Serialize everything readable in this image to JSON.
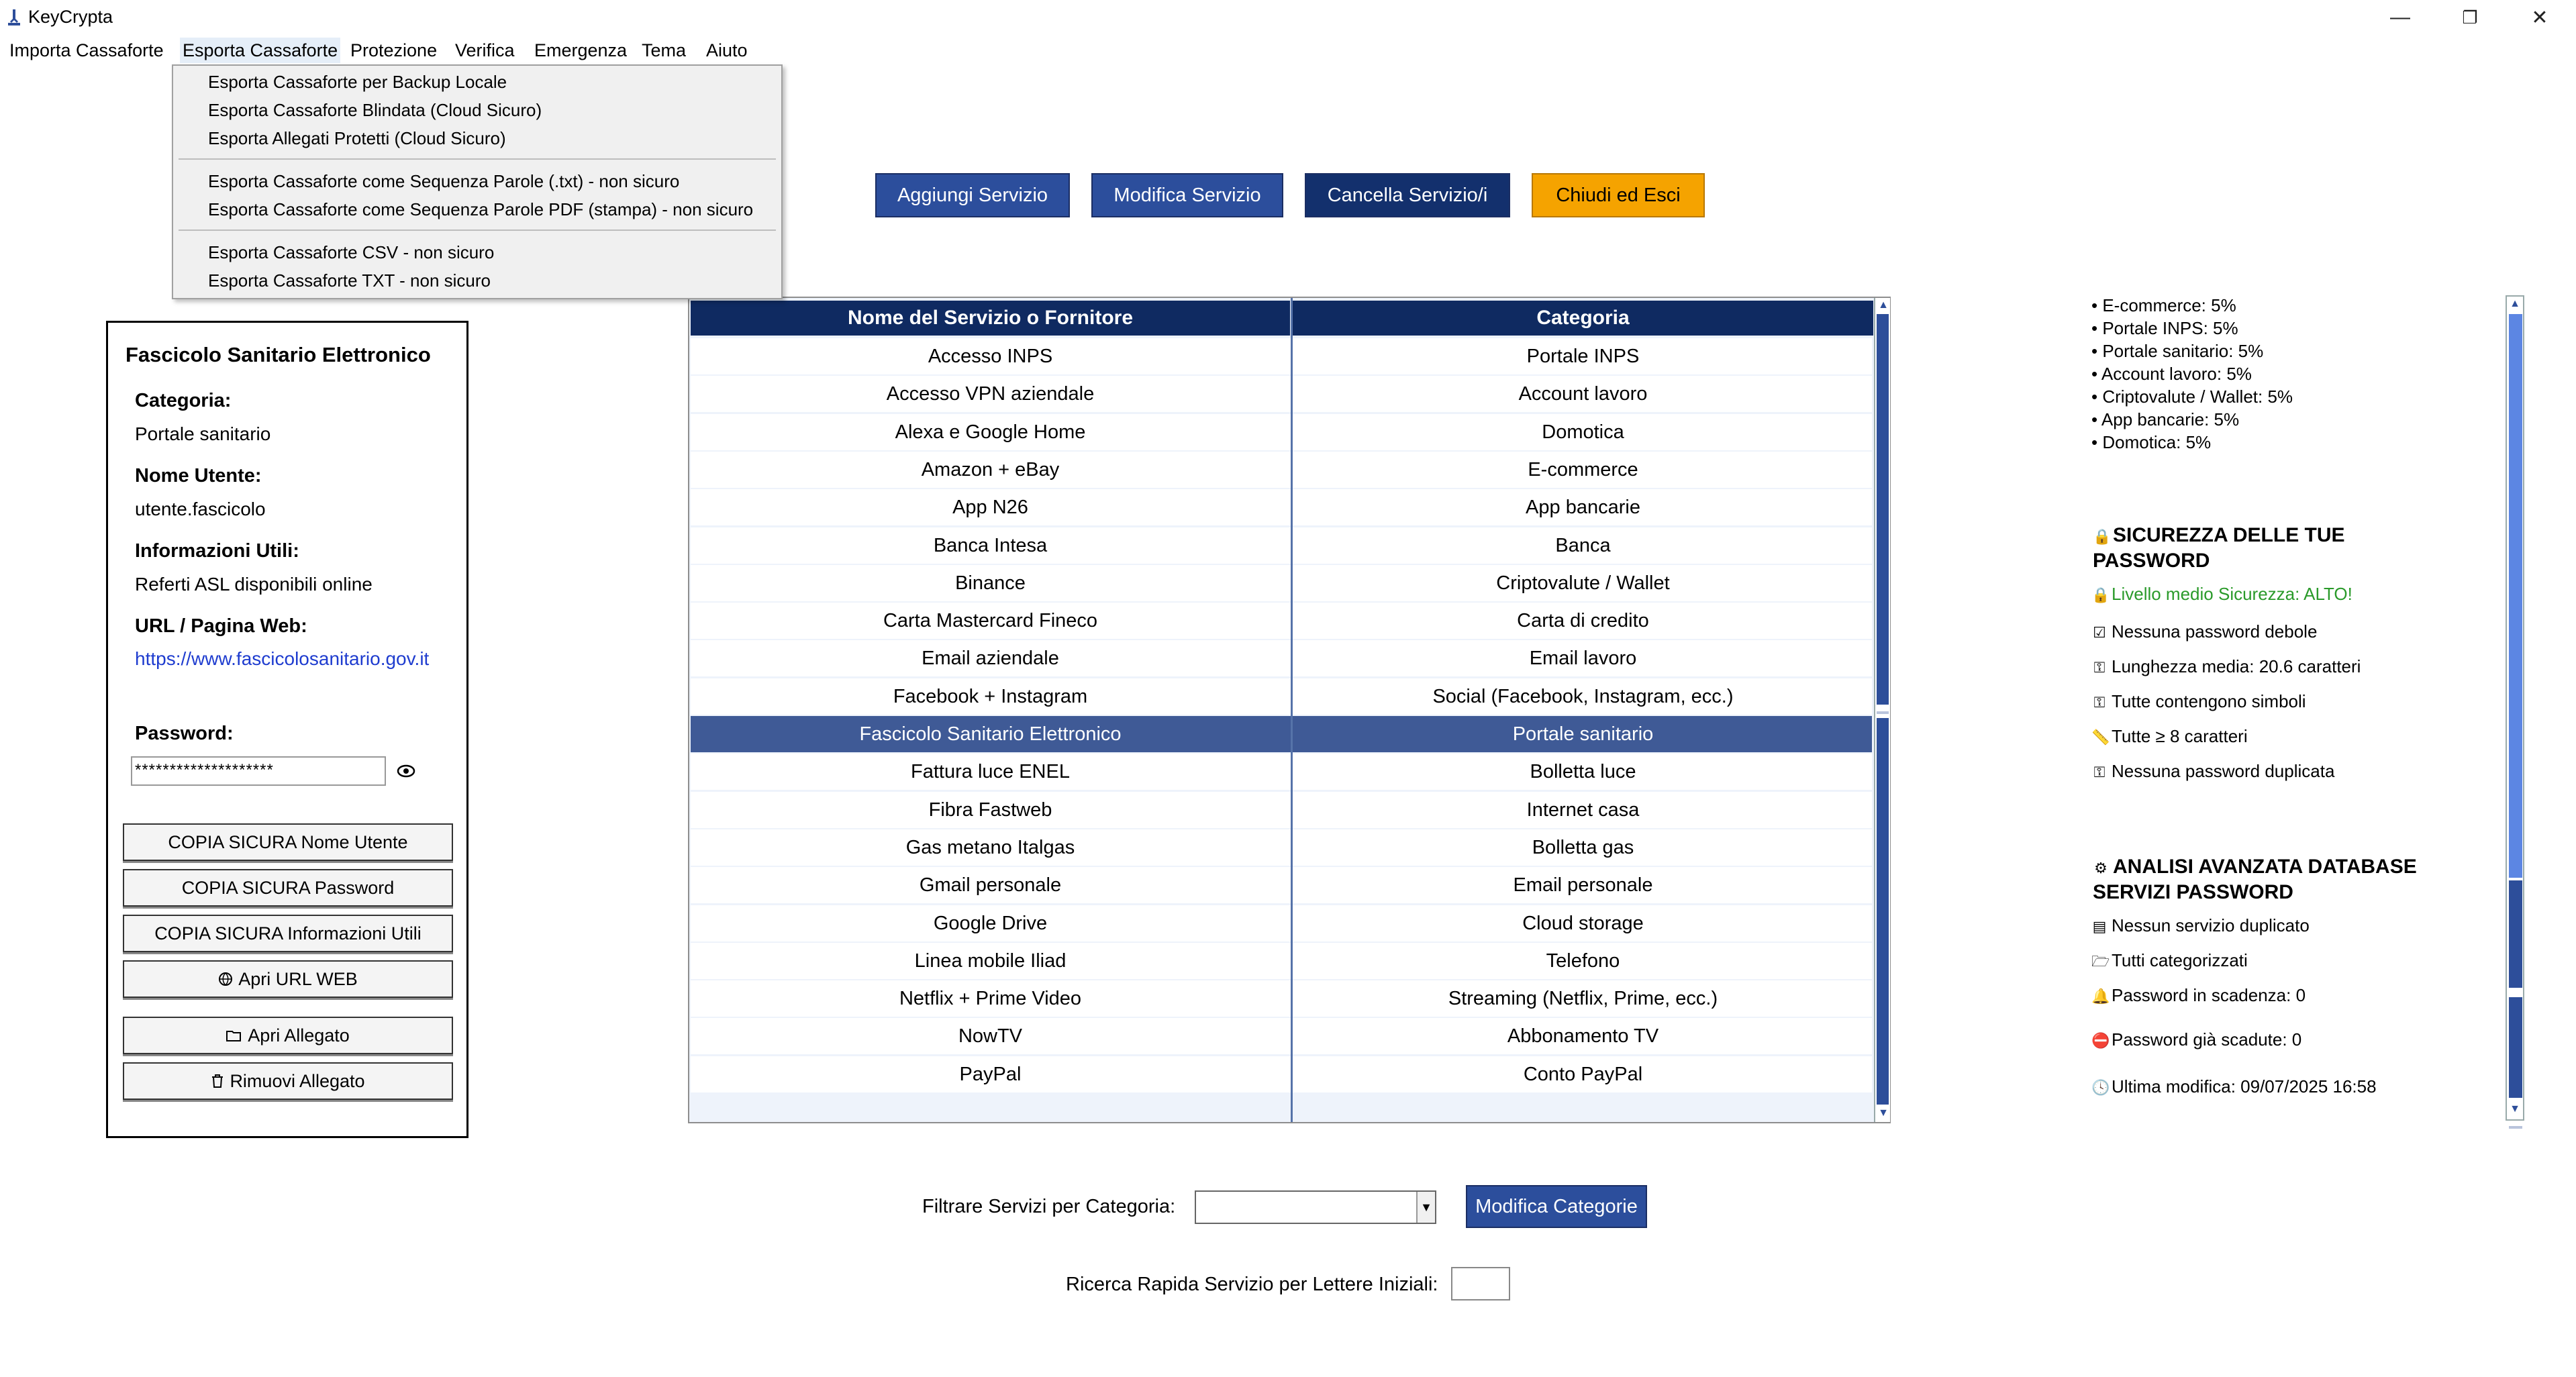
{
  "window": {
    "title": "KeyCrypta",
    "controls": {
      "minimize": "—",
      "maximize": "❐",
      "close": "✕"
    }
  },
  "menubar": {
    "items": [
      "Importa Cassaforte",
      "Esporta Cassaforte",
      "Protezione",
      "Verifica",
      "Emergenza",
      "Tema",
      "Aiuto"
    ]
  },
  "export_menu": {
    "items": [
      "Esporta Cassaforte per Backup Locale",
      "Esporta Cassaforte Blindata (Cloud Sicuro)",
      "Esporta Allegati Protetti (Cloud Sicuro)",
      "Esporta Cassaforte come Sequenza Parole (.txt) - non sicuro",
      "Esporta Cassaforte come Sequenza Parole PDF (stampa) - non sicuro",
      "Esporta Cassaforte CSV - non sicuro",
      "Esporta Cassaforte TXT - non sicuro"
    ]
  },
  "toolbar": {
    "add": "Aggiungi Servizio",
    "edit": "Modifica Servizio",
    "delete": "Cancella Servizio/i",
    "exit": "Chiudi ed Esci",
    "colors": {
      "blue": "#2c4e9c",
      "dark": "#13306d",
      "orange": "#f5a300"
    }
  },
  "details": {
    "title": "Fascicolo Sanitario Elettronico",
    "category_label": "Categoria:",
    "category": "Portale sanitario",
    "username_label": "Nome Utente:",
    "username": "utente.fascicolo",
    "info_label": "Informazioni Utili:",
    "info": "Referti ASL disponibili online",
    "url_label": "URL / Pagina Web:",
    "url": "https://www.fascicolosanitario.gov.it",
    "password_label": "Password:",
    "password_masked": "********************",
    "buttons": {
      "copy_user": "COPIA SICURA Nome Utente",
      "copy_password": "COPIA SICURA Password",
      "copy_info": "COPIA SICURA Informazioni Utili",
      "open_url": "Apri URL WEB",
      "open_attachment": "Apri Allegato",
      "remove_attachment": "Rimuovi Allegato"
    }
  },
  "table": {
    "headers": [
      "Nome del Servizio o Fornitore",
      "Categoria"
    ],
    "selected_index": 10,
    "rows": [
      [
        "Accesso INPS",
        "Portale INPS"
      ],
      [
        "Accesso VPN aziendale",
        "Account lavoro"
      ],
      [
        "Alexa e Google Home",
        "Domotica"
      ],
      [
        "Amazon + eBay",
        "E-commerce"
      ],
      [
        "App N26",
        "App bancarie"
      ],
      [
        "Banca Intesa",
        "Banca"
      ],
      [
        "Binance",
        "Criptovalute / Wallet"
      ],
      [
        "Carta Mastercard Fineco",
        "Carta di credito"
      ],
      [
        "Email aziendale",
        "Email lavoro"
      ],
      [
        "Facebook + Instagram",
        "Social (Facebook, Instagram, ecc.)"
      ],
      [
        "Fascicolo Sanitario Elettronico",
        "Portale sanitario"
      ],
      [
        "Fattura luce ENEL",
        "Bolletta luce"
      ],
      [
        "Fibra Fastweb",
        "Internet casa"
      ],
      [
        "Gas metano Italgas",
        "Bolletta gas"
      ],
      [
        "Gmail personale",
        "Email personale"
      ],
      [
        "Google Drive",
        "Cloud storage"
      ],
      [
        "Linea mobile Iliad",
        "Telefono"
      ],
      [
        "Netflix + Prime Video",
        "Streaming (Netflix, Prime, ecc.)"
      ],
      [
        "NowTV",
        "Abbonamento TV"
      ],
      [
        "PayPal",
        "Conto PayPal"
      ]
    ]
  },
  "filter": {
    "label": "Filtrare Servizi per Categoria:",
    "selected": "",
    "edit_categories": "Modifica Categorie",
    "search_label": "Ricerca Rapida Servizio per Lettere Iniziali:",
    "search_value": ""
  },
  "stats": {
    "category_share": [
      "• E-commerce: 5%",
      "• Portale INPS: 5%",
      "• Portale sanitario: 5%",
      "• Account lavoro: 5%",
      "• Criptovalute / Wallet: 5%",
      "• App bancarie: 5%",
      "• Domotica: 5%"
    ],
    "security_title": "SICUREZZA DELLE TUE PASSWORD",
    "security_level": "Livello medio Sicurezza: ALTO!",
    "security_items": [
      "Nessuna password debole",
      "Lunghezza media: 20.6 caratteri",
      "Tutte contengono simboli",
      "Tutte ≥ 8 caratteri",
      "Nessuna password duplicata"
    ],
    "analysis_title": "ANALISI AVANZATA DATABASE SERVIZI PASSWORD",
    "analysis_items": [
      "Nessun servizio duplicato",
      "Tutti categorizzati",
      "Password in scadenza: 0",
      "Password già scadute: 0",
      "Ultima modifica: 09/07/2025 16:58"
    ],
    "icons": {
      "security_title": "lock-icon",
      "security_level": "lock-icon",
      "weak": "checkbox-icon",
      "length": "key-icon",
      "symbols": "key-icon",
      "min_length": "key-icon",
      "duplicate": "key-icon",
      "analysis_title": "analysis-icon",
      "no_duplicate_service": "document-icon",
      "categorized": "folder-icon",
      "expiring": "bell-icon",
      "expired": "no-entry-icon",
      "last_modified": "clock-icon"
    }
  }
}
